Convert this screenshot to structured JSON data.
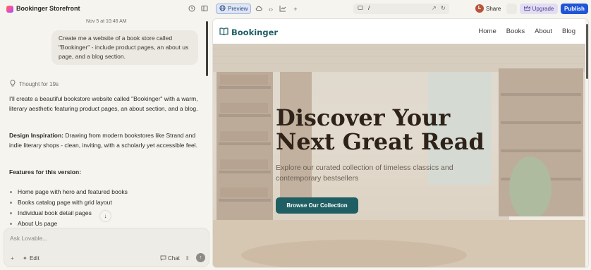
{
  "app": {
    "project_title": "Bookinger Storefront",
    "preview_label": "Preview",
    "url_path": "/",
    "user_initial": "L",
    "share_label": "Share",
    "upgrade_label": "Upgrade",
    "publish_label": "Publish",
    "accent_color": "#2155d8"
  },
  "chat": {
    "date": "Nov 5 at 10:46 AM",
    "user_message": "Create me a website of a book store called \"Bookinger\" - include product pages, an about us page, and a blog section.",
    "thought": "Thought for 19s",
    "intro": "I'll create a beautiful bookstore website called \"Bookinger\" with a warm, literary aesthetic featuring product pages, an about section, and a blog.",
    "inspiration_heading": "Design Inspiration:",
    "inspiration_text": " Drawing from modern bookstores like Strand and indie literary shops - clean, inviting, with a scholarly yet accessible feel.",
    "features_heading": "Features for this version:",
    "features": [
      "Home page with hero and featured books",
      "Books catalog page with grid layout",
      "Individual book detail pages",
      "About Us page"
    ],
    "composer_placeholder": "Ask Lovable...",
    "edit_label": "Edit",
    "chat_label": "Chat"
  },
  "site": {
    "brand": "Bookinger",
    "brand_color": "#1e5e66",
    "nav": [
      "Home",
      "Books",
      "About",
      "Blog"
    ],
    "hero_title": "Discover Your Next Great Read",
    "hero_subtitle": "Explore our curated collection of timeless classics and contemporary bestsellers",
    "cta_label": "Browse Our Collection"
  }
}
